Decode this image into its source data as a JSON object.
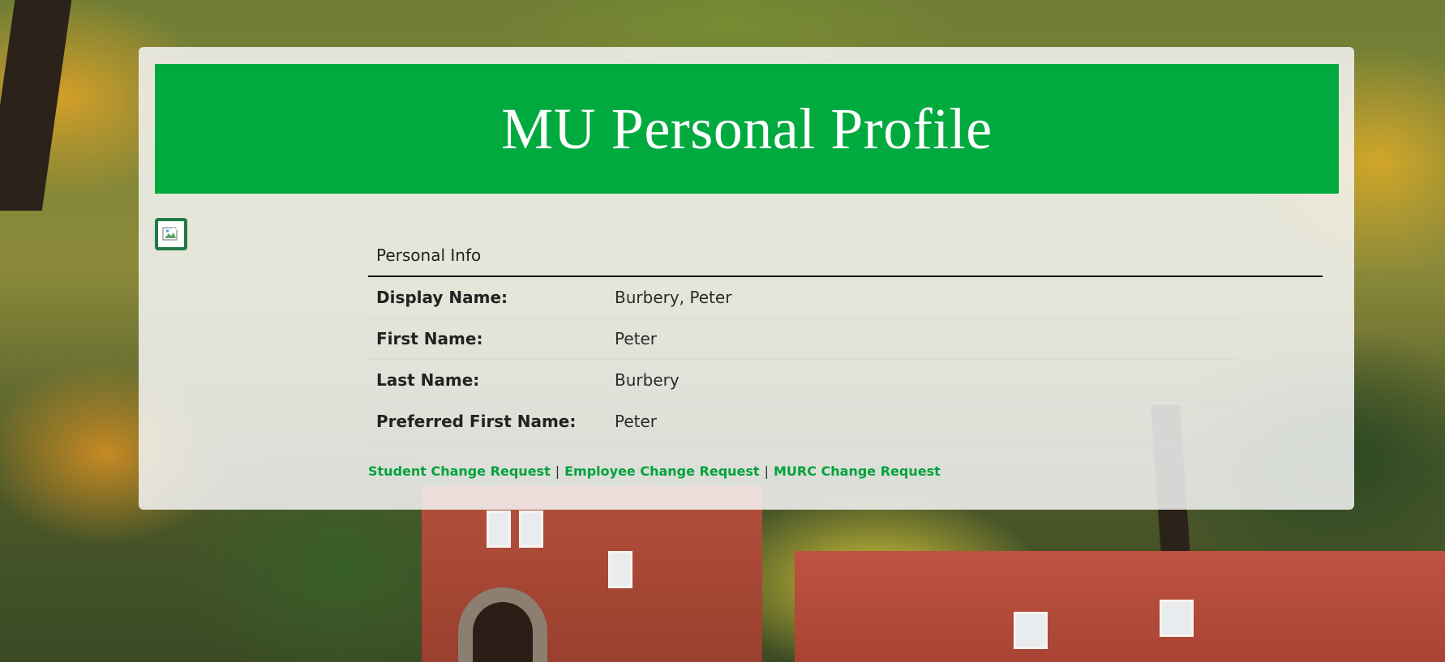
{
  "header": {
    "title": "MU Personal Profile"
  },
  "avatar": {
    "icon": "broken-image-icon"
  },
  "personal_info": {
    "heading": "Personal Info",
    "rows": [
      {
        "label": "Display Name:",
        "value": "Burbery, Peter"
      },
      {
        "label": "First Name:",
        "value": "Peter"
      },
      {
        "label": "Last Name:",
        "value": "Burbery"
      },
      {
        "label": "Preferred First Name:",
        "value": "Peter"
      }
    ]
  },
  "links": {
    "separator": "|",
    "items": [
      {
        "label": "Student Change Request"
      },
      {
        "label": "Employee Change Request"
      },
      {
        "label": "MURC Change Request"
      }
    ]
  },
  "colors": {
    "brand_green": "#00aa3f",
    "link_green": "#00a23c",
    "avatar_border": "#1e7a44"
  }
}
